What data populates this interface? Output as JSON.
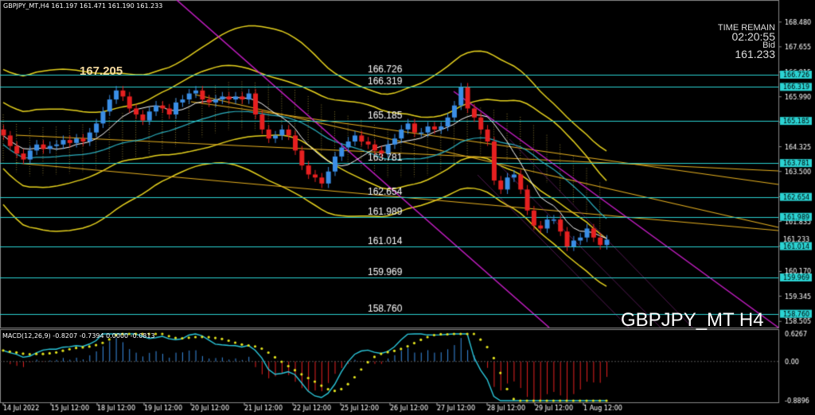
{
  "header": {
    "symbol": "GBPJPY_MT,H4",
    "ohlc": "161.197 161.471 161.190 161.233"
  },
  "big_label": "167.205",
  "time_block": {
    "label": "TIME REMAIN",
    "time": "02:20:55",
    "bid_label": "Bid",
    "bid": "161.233"
  },
  "watermark": "GBPJPY_MT H4",
  "macd": {
    "label": "MACD(12,26,9) -0.8207 -0.7394 0.0000 -0.0813",
    "axis_ticks": [
      "0.6267",
      "0.00",
      "-0.8896"
    ],
    "axis_values": [
      0.6267,
      0.0,
      -0.8896
    ]
  },
  "colors": {
    "background": "#000000",
    "bull": "#3a8ee6",
    "bear": "#e62020",
    "level_line": "#2bd3d3",
    "channel": "#c81ec8",
    "bands": "#e6d21e",
    "ma": "#ffffff",
    "macd_signal": "#e6e61e",
    "macd_main": "#2bc8dc"
  },
  "chart_data": {
    "type": "candlestick",
    "price_axis": {
      "range": [
        158.3,
        168.95
      ],
      "ticks": [
        "168.480",
        "167.655",
        "166.815",
        "165.990",
        "165.150",
        "164.325",
        "163.500",
        "162.660",
        "161.835",
        "161.010",
        "160.170",
        "159.345",
        "158.505"
      ]
    },
    "time_axis": {
      "labels": [
        "14 Jul 2022",
        "15 Jul 12:00",
        "18 Jul 12:00",
        "19 Jul 12:00",
        "20 Jul 12:00",
        "21 Jul 12:00",
        "22 Jul 12:00",
        "25 Jul 12:00",
        "26 Jul 12:00",
        "27 Jul 12:00",
        "28 Jul 12:00",
        "29 Jul 12:00",
        "1 Aug 12:00"
      ]
    },
    "levels": [
      {
        "price": 166.726,
        "label": "166.726"
      },
      {
        "price": 166.319,
        "label": "166.319"
      },
      {
        "price": 165.185,
        "label": "165.185"
      },
      {
        "price": 163.781,
        "label": "163.781"
      },
      {
        "price": 162.654,
        "label": "162.654"
      },
      {
        "price": 161.989,
        "label": "161.989"
      },
      {
        "price": 161.014,
        "label": "161.014"
      },
      {
        "price": 159.969,
        "label": "159.969"
      },
      {
        "price": 158.76,
        "label": "158.760"
      }
    ],
    "level_tags": [
      {
        "price": 166.726,
        "label": "166.726"
      },
      {
        "price": 166.319,
        "label": "166.319"
      },
      {
        "price": 165.185,
        "label": "165.185"
      },
      {
        "price": 163.781,
        "label": "163.781"
      },
      {
        "price": 162.654,
        "label": "162.654"
      },
      {
        "price": 161.989,
        "label": "161.989"
      },
      {
        "price": 161.233,
        "label": "161.233"
      },
      {
        "price": 161.014,
        "label": "161.014"
      },
      {
        "price": 159.969,
        "label": "159.969"
      },
      {
        "price": 158.76,
        "label": "158.760"
      }
    ],
    "close_series": [
      164.7,
      164.35,
      164.1,
      163.9,
      164.2,
      164.4,
      164.25,
      164.35,
      164.4,
      164.55,
      164.45,
      164.6,
      164.5,
      164.8,
      165.1,
      165.5,
      165.9,
      166.2,
      166.0,
      165.6,
      165.4,
      165.2,
      165.5,
      165.7,
      165.6,
      165.4,
      165.8,
      165.9,
      166.1,
      166.2,
      165.9,
      165.8,
      165.9,
      166.0,
      165.9,
      166.0,
      165.9,
      166.1,
      165.4,
      164.9,
      164.6,
      164.7,
      164.9,
      164.7,
      164.2,
      163.7,
      163.4,
      163.3,
      163.1,
      163.5,
      164.0,
      164.3,
      164.5,
      164.7,
      164.5,
      164.4,
      164.2,
      164.1,
      164.4,
      164.6,
      164.9,
      165.1,
      164.8,
      164.8,
      165.0,
      164.9,
      165.0,
      165.3,
      165.7,
      166.3,
      165.6,
      165.3,
      164.9,
      164.5,
      163.2,
      162.9,
      163.3,
      163.4,
      162.9,
      162.2,
      161.7,
      161.6,
      161.9,
      161.9,
      161.5,
      161.0,
      161.2,
      161.3,
      161.6,
      161.3,
      161.05,
      161.23
    ]
  }
}
